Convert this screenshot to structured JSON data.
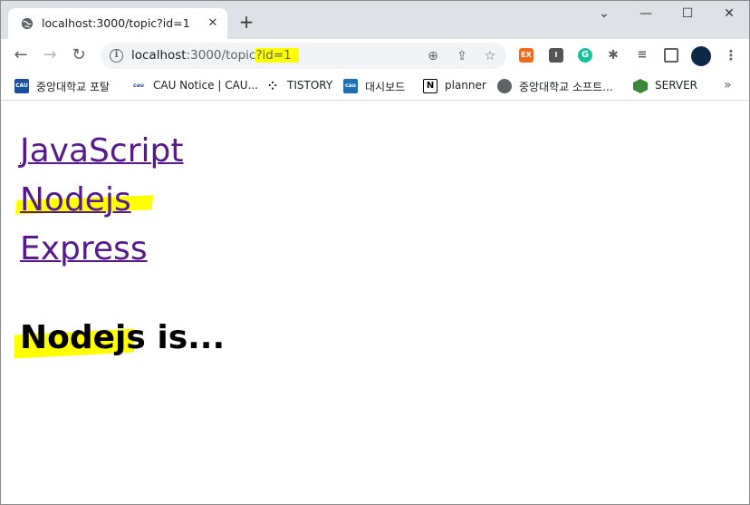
{
  "browser": {
    "tab_title": "localhost:3000/topic?id=1",
    "url_host": "localhost",
    "url_port_path": ":3000/topic",
    "url_query": "?id=1",
    "window_controls": [
      "chevron-down",
      "minimize",
      "maximize",
      "close"
    ]
  },
  "bookmarks": [
    {
      "label": "중앙대학교 포탈",
      "icon": "CAU",
      "color": "#1b4f9c"
    },
    {
      "label": "CAU Notice | CAU...",
      "icon": "cau",
      "color": "#ffffff"
    },
    {
      "label": "TISTORY",
      "icon": "tistory",
      "color": "#ffffff"
    },
    {
      "label": "대시보드",
      "icon": "cau",
      "color": "#1f6fb5"
    },
    {
      "label": "planner",
      "icon": "N",
      "color": "#ffffff"
    },
    {
      "label": "중앙대학교 소프트...",
      "icon": "globe",
      "color": "#ffffff"
    },
    {
      "label": "SERVER",
      "icon": "node",
      "color": "#3c873a"
    }
  ],
  "page": {
    "links": [
      "JavaScript",
      "Nodejs",
      "Express"
    ],
    "topic_name": "Nodejs",
    "topic_suffix": " is..."
  },
  "colors": {
    "highlight": "#ffff00",
    "visited_link": "#551a8b"
  }
}
